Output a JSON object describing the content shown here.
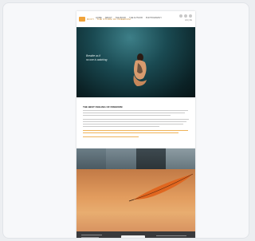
{
  "site": {
    "logo_text": "ROXY · THE STORM OF FREEDOM",
    "nav": [
      "HOME",
      "ABOUT",
      "THE BOOK",
      "THE AUTHOR",
      "PHOTOGRAPHY",
      "EVENTS",
      "CONTACT"
    ],
    "language": "EN | DE"
  },
  "hero": {
    "line1": "Breathe as if",
    "line2": "no one is watching"
  },
  "article": {
    "title": "THE BEST FEELING OF FREEDOM",
    "paragraph_count": 3
  },
  "colors": {
    "accent": "#f0a33a",
    "hero_dark": "#0b2226",
    "footer": "#3a3a3c"
  },
  "icons": [
    "logo-icon",
    "social-icon",
    "diver-figure",
    "feather-icon"
  ]
}
